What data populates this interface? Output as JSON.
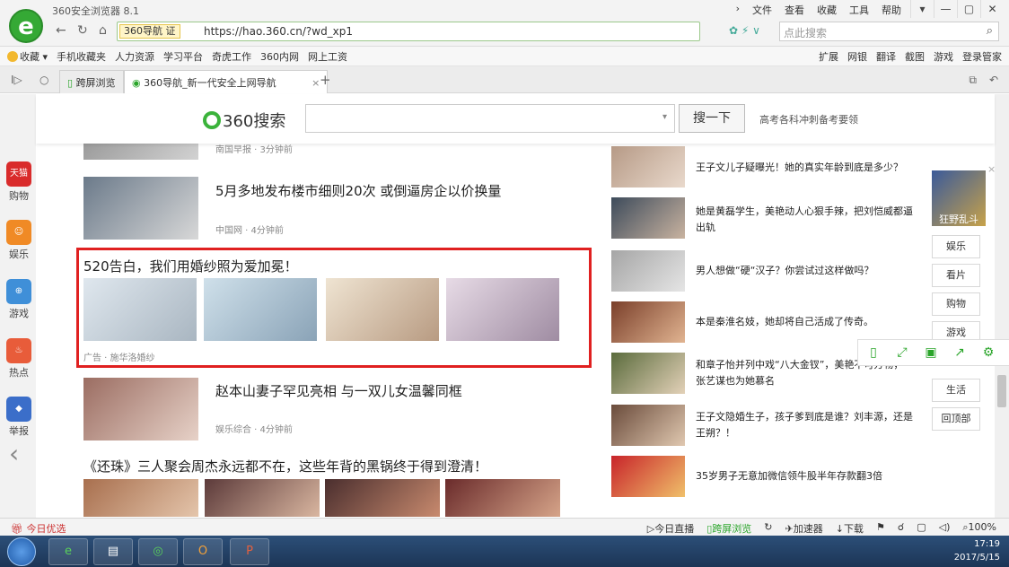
{
  "browser": {
    "app_title": "360安全浏览器 8.1",
    "menu": [
      "文件",
      "查看",
      "收藏",
      "工具",
      "帮助"
    ],
    "window_controls": [
      "shirt-icon",
      "minimize-icon",
      "maximize-icon",
      "close-icon"
    ],
    "address_tag": "360导航 证",
    "url": "https://hao.360.cn/?wd_xp1",
    "url_host": "hao.360.cn",
    "search_placeholder": "点此搜索",
    "bookmarks_left": [
      "收藏",
      "手机收藏夹",
      "人力资源",
      "学习平台",
      "奇虎工作",
      "360内网",
      "网上工资"
    ],
    "bookmarks_right": [
      "扩展",
      "网银",
      "翻译",
      "截图",
      "游戏",
      "登录管家"
    ],
    "tabs": [
      {
        "label": "跨屏浏览"
      },
      {
        "label": "360导航_新一代安全上网导航"
      }
    ]
  },
  "left_sidebar": [
    {
      "label": "购物",
      "icon_text": "天猫",
      "color": "#d92b2b"
    },
    {
      "label": "娱乐",
      "icon_text": "",
      "color": "#f08a25"
    },
    {
      "label": "游戏",
      "icon_text": "",
      "color": "#3f8fd8"
    },
    {
      "label": "热点",
      "icon_text": "",
      "color": "#e85c3a"
    },
    {
      "label": "举报",
      "icon_text": "",
      "color": "#3b6ec9"
    }
  ],
  "search": {
    "logo_text": "360搜索",
    "button": "搜一下",
    "hint": "高考各科冲刺备考要领"
  },
  "news": [
    {
      "meta_source": "南国早报",
      "meta_time": "3分钟前"
    },
    {
      "title": "5月多地发布楼市细则20次 或倒逼房企以价换量",
      "meta_source": "中国网",
      "meta_time": "4分钟前"
    },
    {
      "title": "赵本山妻子罕见亮相 与一双儿女温馨同框",
      "meta_source": "娱乐综合",
      "meta_time": "4分钟前"
    },
    {
      "title": "《还珠》三人聚会周杰永远都不在，这些年背的黑锅终于得到澄清！"
    }
  ],
  "ad": {
    "title": "520告白，我们用婚纱照为爱加冕！",
    "label": "广告",
    "sponsor": "施华洛婚纱"
  },
  "right_list": [
    "王子文儿子疑曝光！她的真实年龄到底是多少？",
    "她是黄磊学生，美艳动人心狠手辣，把刘恺威都逼出轨",
    "男人想做“硬“汉子？你尝试过这样做吗？",
    "本是秦淮名妓，她却将自己活成了传奇。",
    "和章子怡并列中戏“八大金钗”，美艳不可方物，张艺谋也为她慕名",
    "王子文隐婚生子，孩子爹到底是谁？刘丰源，还是王朔？！",
    "35岁男子无意加微信领牛股半年存款翻3倍"
  ],
  "right_widgets": {
    "banner_text": "狂野乱斗",
    "items": [
      "娱乐",
      "看片",
      "购物",
      "游戏",
      "生活",
      "回顶部"
    ]
  },
  "status": {
    "left": "今日优选",
    "right": [
      "今日直播",
      "跨屏浏览",
      "加速器",
      "下载",
      "100%"
    ]
  },
  "taskbar": {
    "time": "17:19",
    "date": "2017/5/15",
    "apps": [
      "ie-icon",
      "explorer-icon",
      "wechat-icon",
      "outlook-icon",
      "powerpoint-icon"
    ]
  }
}
